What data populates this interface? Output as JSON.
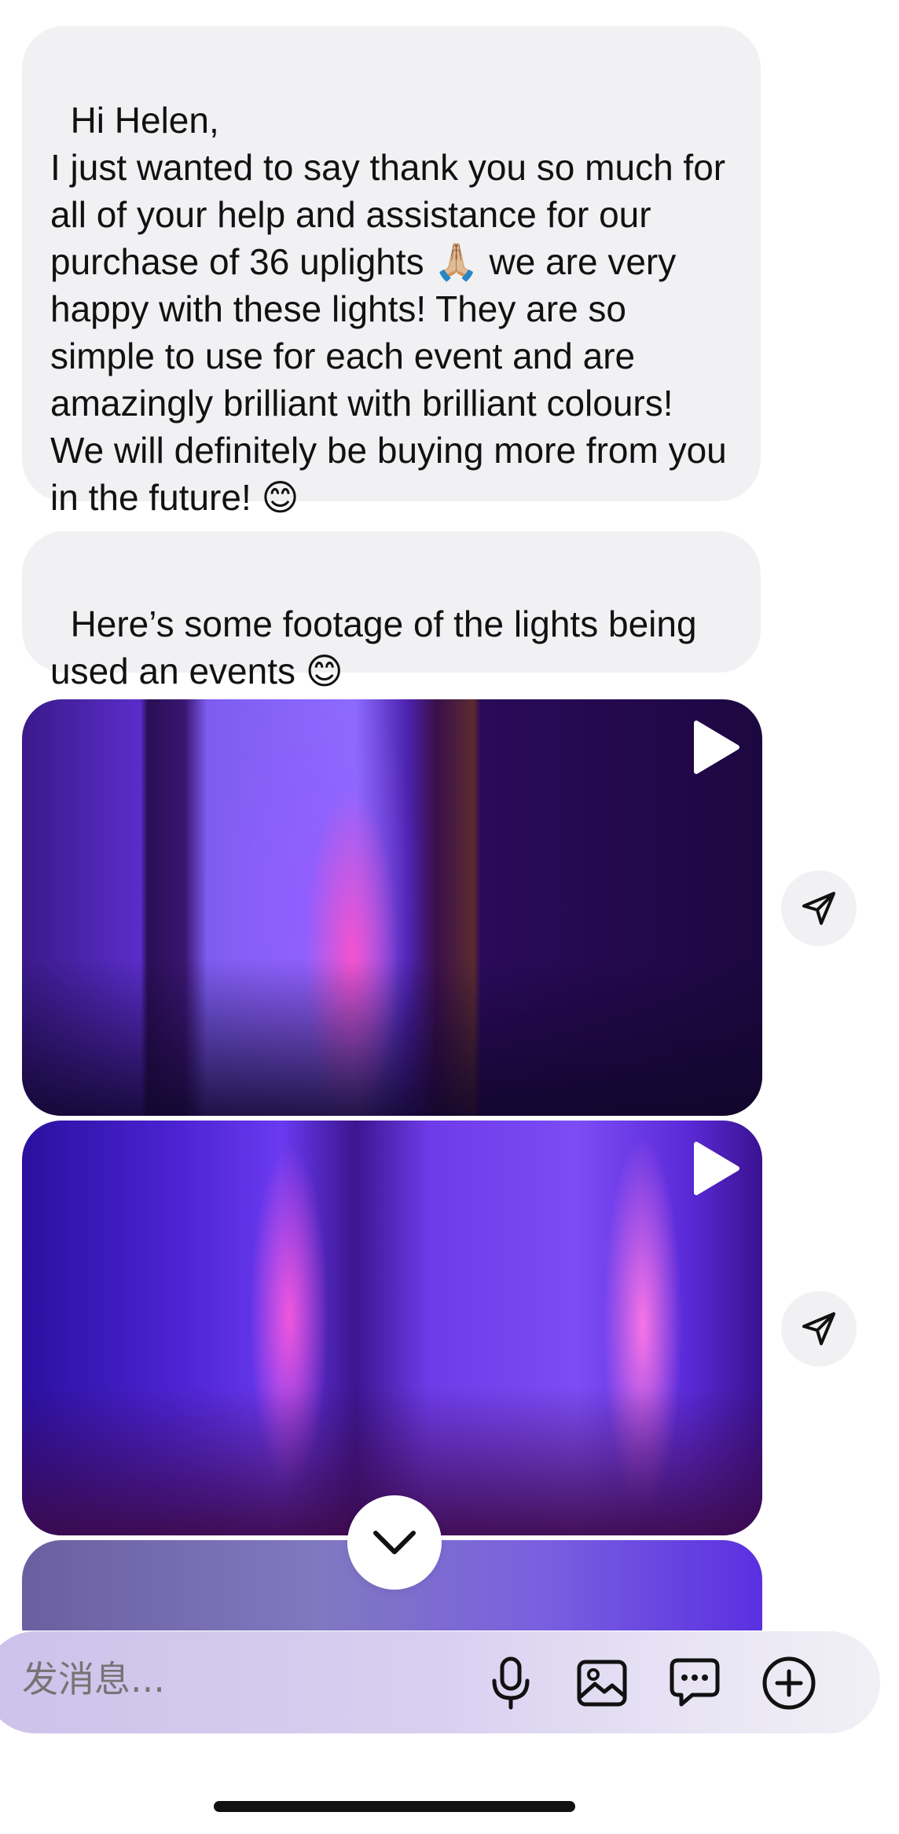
{
  "messages": [
    {
      "text": "Hi Helen,\nI just wanted to say thank you so much for all of your help and assistance for our purchase of 36 uplights 🙏🏼 we are very happy with these lights! They are so simple to use for each event and are amazingly brilliant with brilliant colours! We will definitely be buying more from you in the future! 😊"
    },
    {
      "text": "Here’s some footage of the lights being used an events 😊"
    }
  ],
  "videos": [
    {
      "icon": "play-icon"
    },
    {
      "icon": "play-icon"
    },
    {
      "icon": "play-icon"
    }
  ],
  "composer": {
    "placeholder": "发消息...",
    "icons": [
      "microphone-icon",
      "image-icon",
      "chat-bubble-icon",
      "plus-circle-icon"
    ]
  },
  "colors": {
    "bubble_bg": "#f1f1f3",
    "composer_gradient_start": "#cdc2ea",
    "text": "#111111"
  }
}
